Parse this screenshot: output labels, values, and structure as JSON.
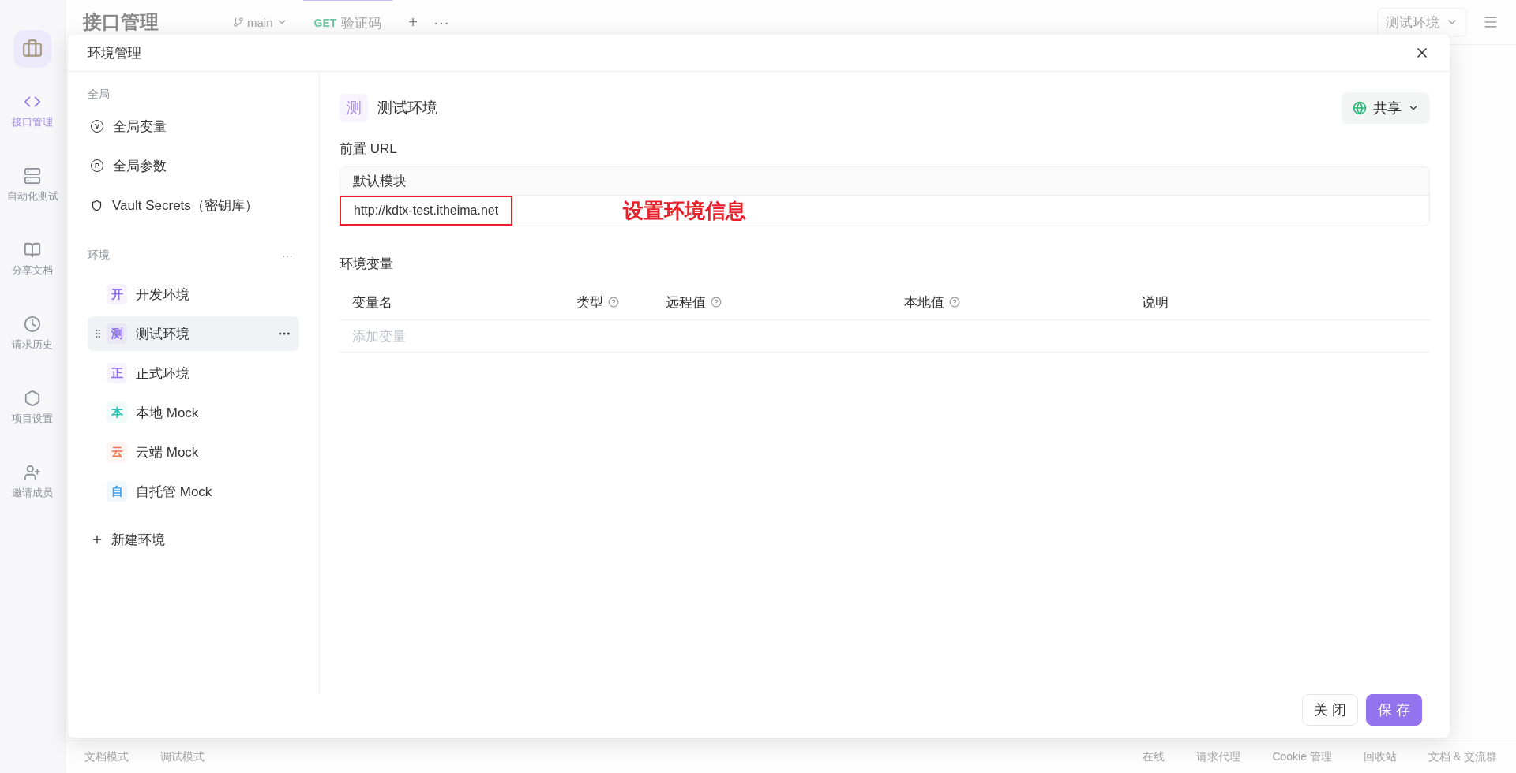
{
  "app_sidebar": {
    "items": [
      {
        "label": "接口管理",
        "kind": "api",
        "selected": true
      },
      {
        "label": "自动化测试",
        "kind": "auto",
        "selected": false
      },
      {
        "label": "分享文档",
        "kind": "docs",
        "selected": false
      },
      {
        "label": "请求历史",
        "kind": "history",
        "selected": false
      },
      {
        "label": "项目设置",
        "kind": "settings",
        "selected": false
      },
      {
        "label": "邀请成员",
        "kind": "invite",
        "selected": false
      }
    ]
  },
  "header": {
    "title": "接口管理",
    "branch": "main",
    "tab": {
      "method": "GET",
      "name": "验证码"
    },
    "add_tab": "+",
    "more": "···",
    "environment": "测试环境"
  },
  "status_bar": {
    "items": [
      "文档模式",
      "调试模式",
      "在线",
      "请求代理",
      "Cookie 管理",
      "回收站",
      "文档 & 交流群"
    ]
  },
  "dialog": {
    "title": "环境管理",
    "global": {
      "label": "全局",
      "items": [
        {
          "label": "全局变量",
          "kind": "letter",
          "letter": "V"
        },
        {
          "label": "全局参数",
          "kind": "letter",
          "letter": "P"
        },
        {
          "label": "Vault Secrets（密钥库）",
          "kind": "shield"
        }
      ]
    },
    "environments": {
      "label": "环境",
      "more": "···",
      "items": [
        {
          "badge": "开",
          "label": "开发环境",
          "color": "#8b6cf0",
          "selected": false
        },
        {
          "badge": "测",
          "label": "测试环境",
          "color": "#8b6cf0",
          "selected": true
        },
        {
          "badge": "正",
          "label": "正式环境",
          "color": "#8b6cf0",
          "selected": false
        },
        {
          "badge": "本",
          "label": "本地 Mock",
          "color": "#2ec4b6",
          "selected": false
        },
        {
          "badge": "云",
          "label": "云端 Mock",
          "color": "#f0734a",
          "selected": false
        },
        {
          "badge": "自",
          "label": "自托管 Mock",
          "color": "#3aa0f0",
          "selected": false
        }
      ],
      "new_label": "新建环境"
    },
    "detail": {
      "badge": "测",
      "name": "测试环境",
      "share": "共享",
      "base_url": {
        "label": "前置 URL",
        "module": "默认模块",
        "value": "http://kdtx-test.itheima.net"
      },
      "annotation": "设置环境信息",
      "variables": {
        "label": "环境变量",
        "columns": [
          {
            "label": "变量名",
            "help": false
          },
          {
            "label": "类型",
            "help": true
          },
          {
            "label": "远程值",
            "help": true
          },
          {
            "label": "本地值",
            "help": true
          },
          {
            "label": "说明",
            "help": false
          }
        ],
        "placeholder": "添加变量"
      }
    },
    "buttons": [
      {
        "label": "关 闭",
        "primary": false
      },
      {
        "label": "保 存",
        "primary": true
      }
    ]
  }
}
